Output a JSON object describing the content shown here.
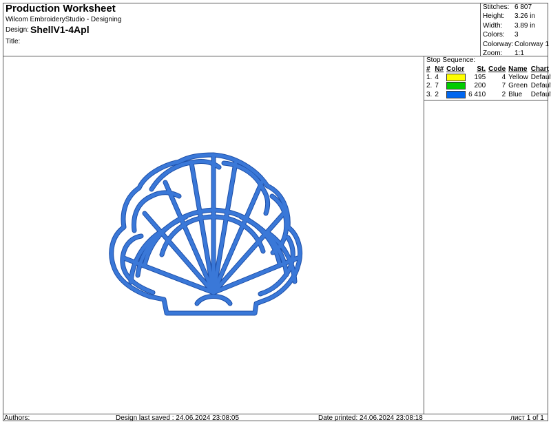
{
  "header": {
    "title": "Production Worksheet",
    "app": "Wilcom EmbroideryStudio - Designing",
    "design_label": "Design:",
    "design_name": "ShellV1-4Apl",
    "title_label": "Title:"
  },
  "info": {
    "stitches_label": "Stitches:",
    "stitches": "6 807",
    "height_label": "Height:",
    "height": "3.26 in",
    "width_label": "Width:",
    "width": "3.89 in",
    "colors_label": "Colors:",
    "colors": "3",
    "colorway_label": "Colorway:",
    "colorway": "Colorway 1",
    "zoom_label": "Zoom:",
    "zoom": "1:1"
  },
  "stop_sequence": {
    "label": "Stop Sequence:",
    "headers": [
      "#",
      "N#",
      "Color",
      "St.",
      "Code",
      "Name",
      "Chart"
    ],
    "rows": [
      {
        "num": "1.",
        "n": "4",
        "swatch": "#ffff00",
        "st": "195",
        "code": "4",
        "name": "Yellow",
        "chart": "Default"
      },
      {
        "num": "2.",
        "n": "7",
        "swatch": "#00cc00",
        "st": "200",
        "code": "7",
        "name": "Green",
        "chart": "Default"
      },
      {
        "num": "3.",
        "n": "2",
        "swatch": "#0066ee",
        "st": "6 410",
        "code": "2",
        "name": "Blue",
        "chart": "Default"
      }
    ]
  },
  "footer": {
    "authors": "Authors:",
    "saved": "Design last saved : 24.06.2024 23:08:05",
    "printed": "Date printed: 24.06.2024 23:08:18",
    "page": "лист 1 of 1"
  },
  "design_color": "#3a78d8"
}
